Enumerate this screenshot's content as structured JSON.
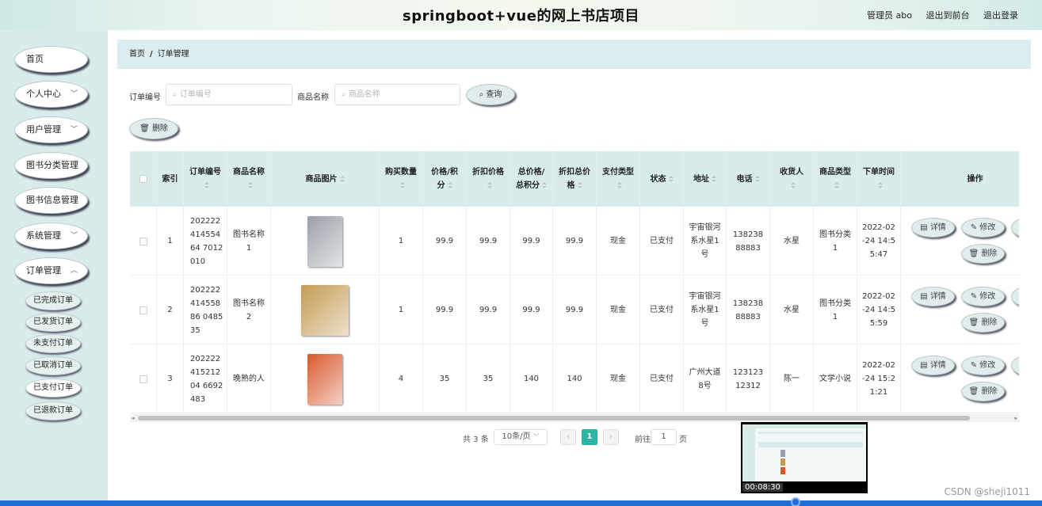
{
  "header": {
    "title": "springboot+vue的网上书店项目",
    "admin": "管理员 abo",
    "back_front": "退出到前台",
    "logout": "退出登录"
  },
  "sidebar": {
    "items": [
      {
        "label": "首页",
        "has_chevron": false
      },
      {
        "label": "个人中心",
        "has_chevron": true
      },
      {
        "label": "用户管理",
        "has_chevron": true
      },
      {
        "label": "图书分类管理",
        "has_chevron": false
      },
      {
        "label": "图书信息管理",
        "has_chevron": false
      },
      {
        "label": "系统管理",
        "has_chevron": true
      },
      {
        "label": "订单管理",
        "has_chevron": true
      }
    ],
    "sub_items": [
      "已完成订单",
      "已发货订单",
      "未支付订单",
      "已取消订单",
      "已支付订单",
      "已退款订单"
    ],
    "active_sub": "已支付订单"
  },
  "breadcrumb": {
    "home": "首页",
    "sep": "/",
    "current": "订单管理"
  },
  "search": {
    "order_label": "订单编号",
    "order_placeholder": "订单编号",
    "goods_label": "商品名称",
    "goods_placeholder": "商品名称",
    "query_button": "查询",
    "delete_button": "删除"
  },
  "table": {
    "headers": [
      "索引",
      "订单编号",
      "商品名称",
      "商品图片",
      "购买数量",
      "价格/积分",
      "折扣价格",
      "总价格/总积分",
      "折扣总价格",
      "支付类型",
      "状态",
      "地址",
      "电话",
      "收货人",
      "商品类型",
      "下单时间",
      "操作"
    ],
    "rows": [
      {
        "index": "1",
        "order_no": "20222241455464 7012010",
        "goods": "图书名称1",
        "qty": "1",
        "price": "99.9",
        "discount": "99.9",
        "total": "99.9",
        "discount_total": "99.9",
        "pay_type": "现金",
        "status": "已支付",
        "address": "宇宙银河系水星1号",
        "phone": "13823888883",
        "receiver": "水星",
        "category": "图书分类1",
        "time": "2022-02-24 14:55:47",
        "cover_color": "#9aa0a8"
      },
      {
        "index": "2",
        "order_no": "20222241455886 048535",
        "goods": "图书名称2",
        "qty": "1",
        "price": "99.9",
        "discount": "99.9",
        "total": "99.9",
        "discount_total": "99.9",
        "pay_type": "现金",
        "status": "已支付",
        "address": "宇宙银河系水星1号",
        "phone": "13823888883",
        "receiver": "水星",
        "category": "图书分类1",
        "time": "2022-02-24 14:55:59",
        "cover_color": "#c49a52"
      },
      {
        "index": "3",
        "order_no": "20222241521204 6692483",
        "goods": "晚熟的人",
        "qty": "4",
        "price": "35",
        "discount": "35",
        "total": "140",
        "discount_total": "140",
        "pay_type": "现金",
        "status": "已支付",
        "address": "广州大道8号",
        "phone": "12312312312",
        "receiver": "陈一",
        "category": "文学小说",
        "time": "2022-02-24 15:21:21",
        "cover_color": "#d9592a"
      }
    ],
    "actions": {
      "detail": "详情",
      "edit": "修改",
      "delete": "删除"
    }
  },
  "pagination": {
    "total": "共 3 条",
    "page_size": "10条/页",
    "current": "1",
    "goto_label": "前往",
    "goto_value": "1",
    "page_unit": "页"
  },
  "video": {
    "time": "00:08:30"
  },
  "watermark": "CSDN @sheji1011"
}
